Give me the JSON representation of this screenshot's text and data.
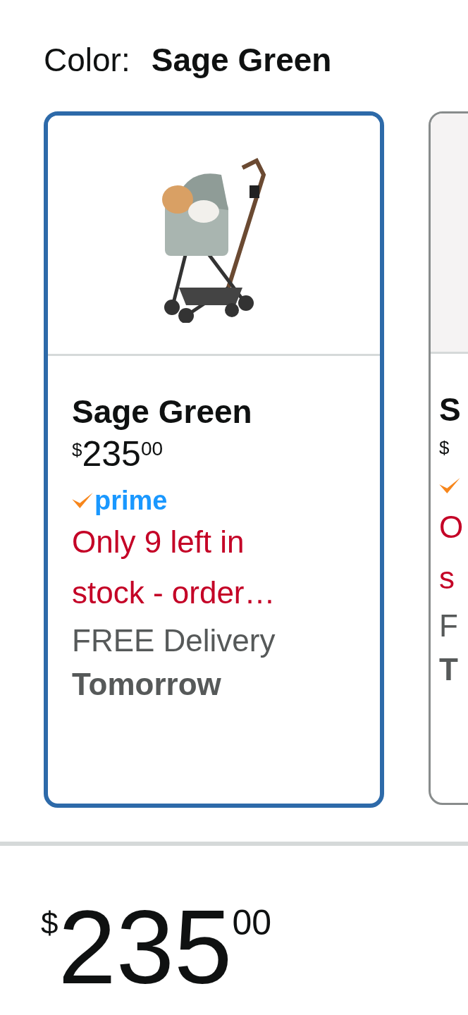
{
  "color_selector": {
    "label": "Color:",
    "value": "Sage Green"
  },
  "swatches": [
    {
      "selected": true,
      "name": "Sage Green",
      "price": {
        "symbol": "$",
        "whole": "235",
        "fraction": "00"
      },
      "prime": "prime",
      "stock": "Only 9 left in stock - order…",
      "delivery": "FREE Delivery",
      "delivery_day": "Tomorrow"
    },
    {
      "selected": false,
      "name": "S",
      "price": {
        "symbol": "$"
      },
      "stock": "O s",
      "delivery": "F",
      "delivery_day": "T"
    }
  ],
  "price": {
    "symbol": "$",
    "whole": "235",
    "fraction": "00"
  }
}
